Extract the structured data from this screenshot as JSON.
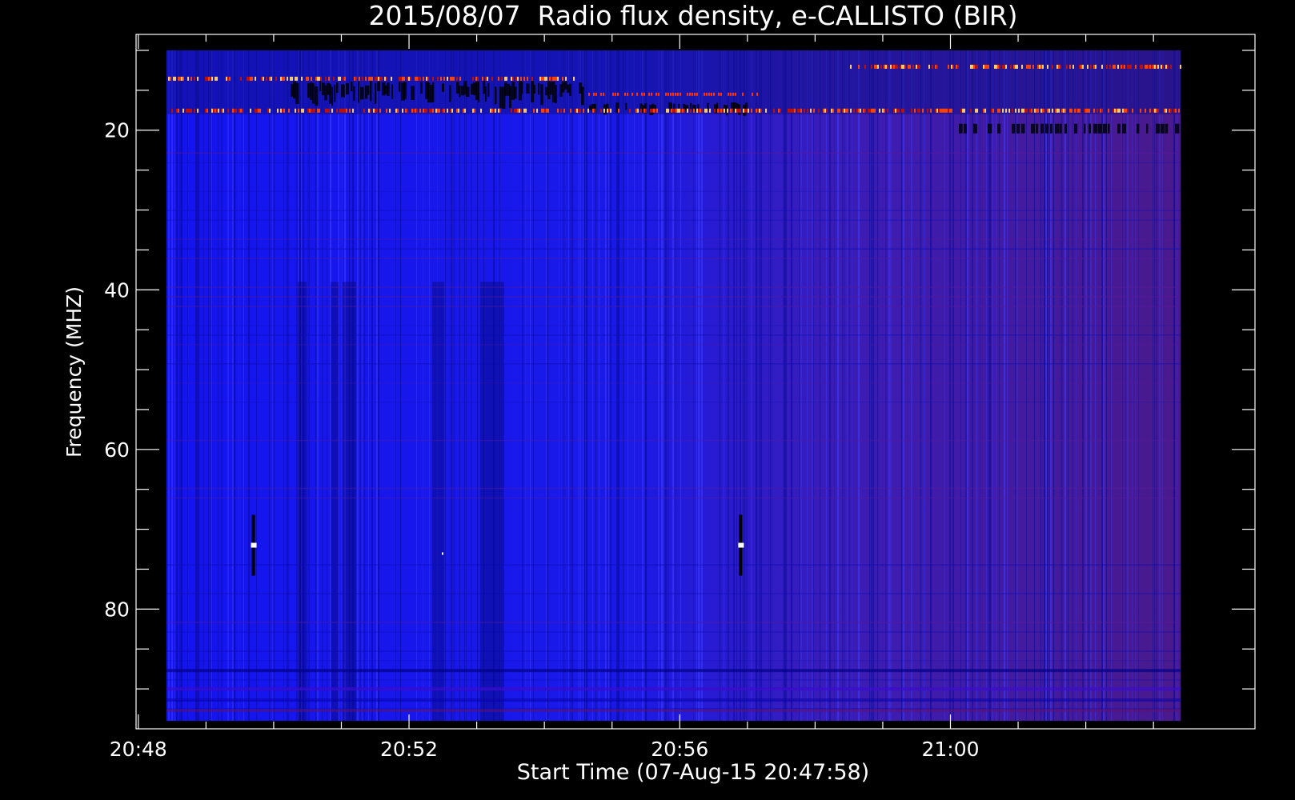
{
  "chart_data": {
    "type": "heatmap",
    "title": "2015/08/07  Radio flux density, e-CALLISTO (BIR)",
    "xlabel": "Start Time (07-Aug-15 20:47:58)",
    "ylabel": "Frequency (MHZ)",
    "x_ticks": [
      "20:48",
      "20:52",
      "20:56",
      "21:00"
    ],
    "y_ticks": [
      "20",
      "40",
      "60",
      "80"
    ],
    "xlim": [
      "20:47:58",
      "21:04:30"
    ],
    "ylim": [
      8,
      95
    ],
    "y_inverted": true,
    "data_time_range": [
      "20:48:25",
      "21:03:24"
    ],
    "data_freq_range_mhz": [
      10,
      94
    ],
    "colormap": [
      "#000000",
      "#2222ff",
      "#4a1a8a",
      "#cc1100",
      "#ff6600",
      "#ffff88"
    ],
    "features": [
      {
        "label": "Interference bands",
        "freq_mhz": [
          12,
          13.5,
          17.5
        ],
        "color": "#ff4400"
      },
      {
        "label": "Short bursts",
        "time": [
          "20:49:42",
          "20:56:54"
        ],
        "freq_mhz": 72,
        "color": "#ffffff"
      }
    ]
  }
}
